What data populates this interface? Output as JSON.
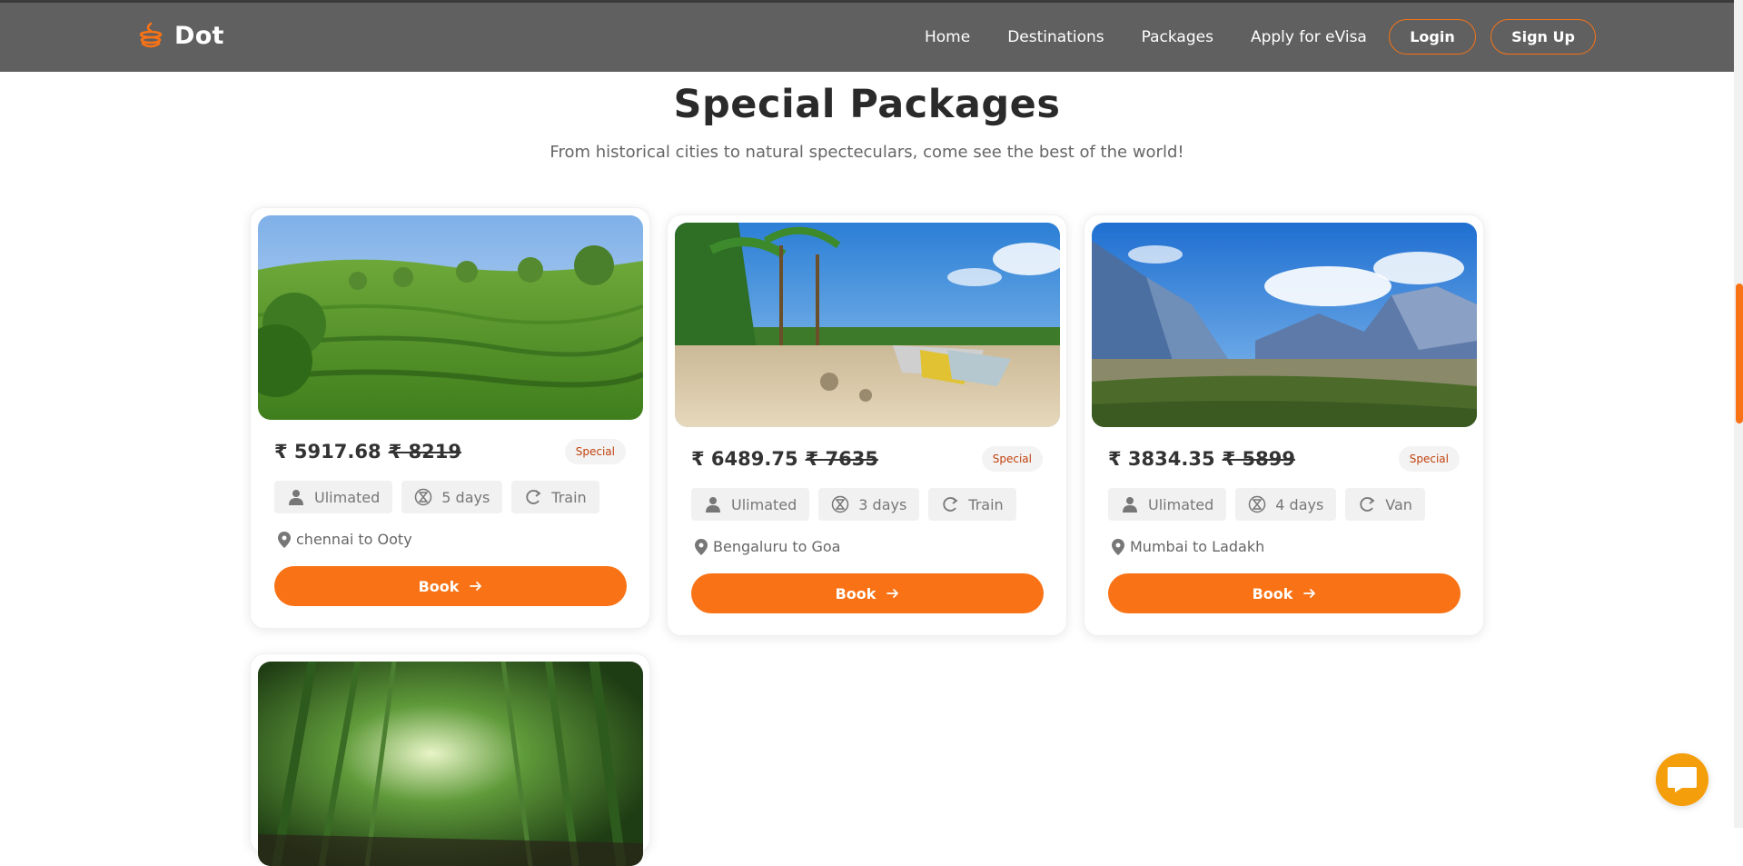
{
  "brand": {
    "name": "Dot",
    "logo_icon": "stacked-orange-logo-icon",
    "accent_color": "#f97316"
  },
  "nav": {
    "links": [
      "Home",
      "Destinations",
      "Packages",
      "Apply for eVisa"
    ],
    "login_label": "Login",
    "signup_label": "Sign Up"
  },
  "section": {
    "title": "Special Packages",
    "subtitle": "From historical cities to natural specteculars, come see the best of the world!"
  },
  "packages": [
    {
      "image": "tea-plantation-hills",
      "price": "₹ 5917.68",
      "old_price": "₹ 8219",
      "badge": "Special",
      "people": "Ulimated",
      "duration": "5 days",
      "transport": "Train",
      "route": "chennai to Ooty",
      "book_label": "Book"
    },
    {
      "image": "beach-canoes-palm-trees",
      "price": "₹ 6489.75",
      "old_price": "₹ 7635",
      "badge": "Special",
      "people": "Ulimated",
      "duration": "3 days",
      "transport": "Train",
      "route": "Bengaluru to Goa",
      "book_label": "Book"
    },
    {
      "image": "mountain-valley",
      "price": "₹ 3834.35",
      "old_price": "₹ 5899",
      "badge": "Special",
      "people": "Ulimated",
      "duration": "4 days",
      "transport": "Van",
      "route": "Mumbai to Ladakh",
      "book_label": "Book"
    },
    {
      "image": "bamboo-forest"
    }
  ],
  "icons": {
    "people": "user-icon",
    "duration": "hourglass-icon",
    "transport": "transport-icon",
    "location": "map-pin-icon",
    "arrow": "arrow-right-icon",
    "chat": "chat-bubble-icon"
  }
}
